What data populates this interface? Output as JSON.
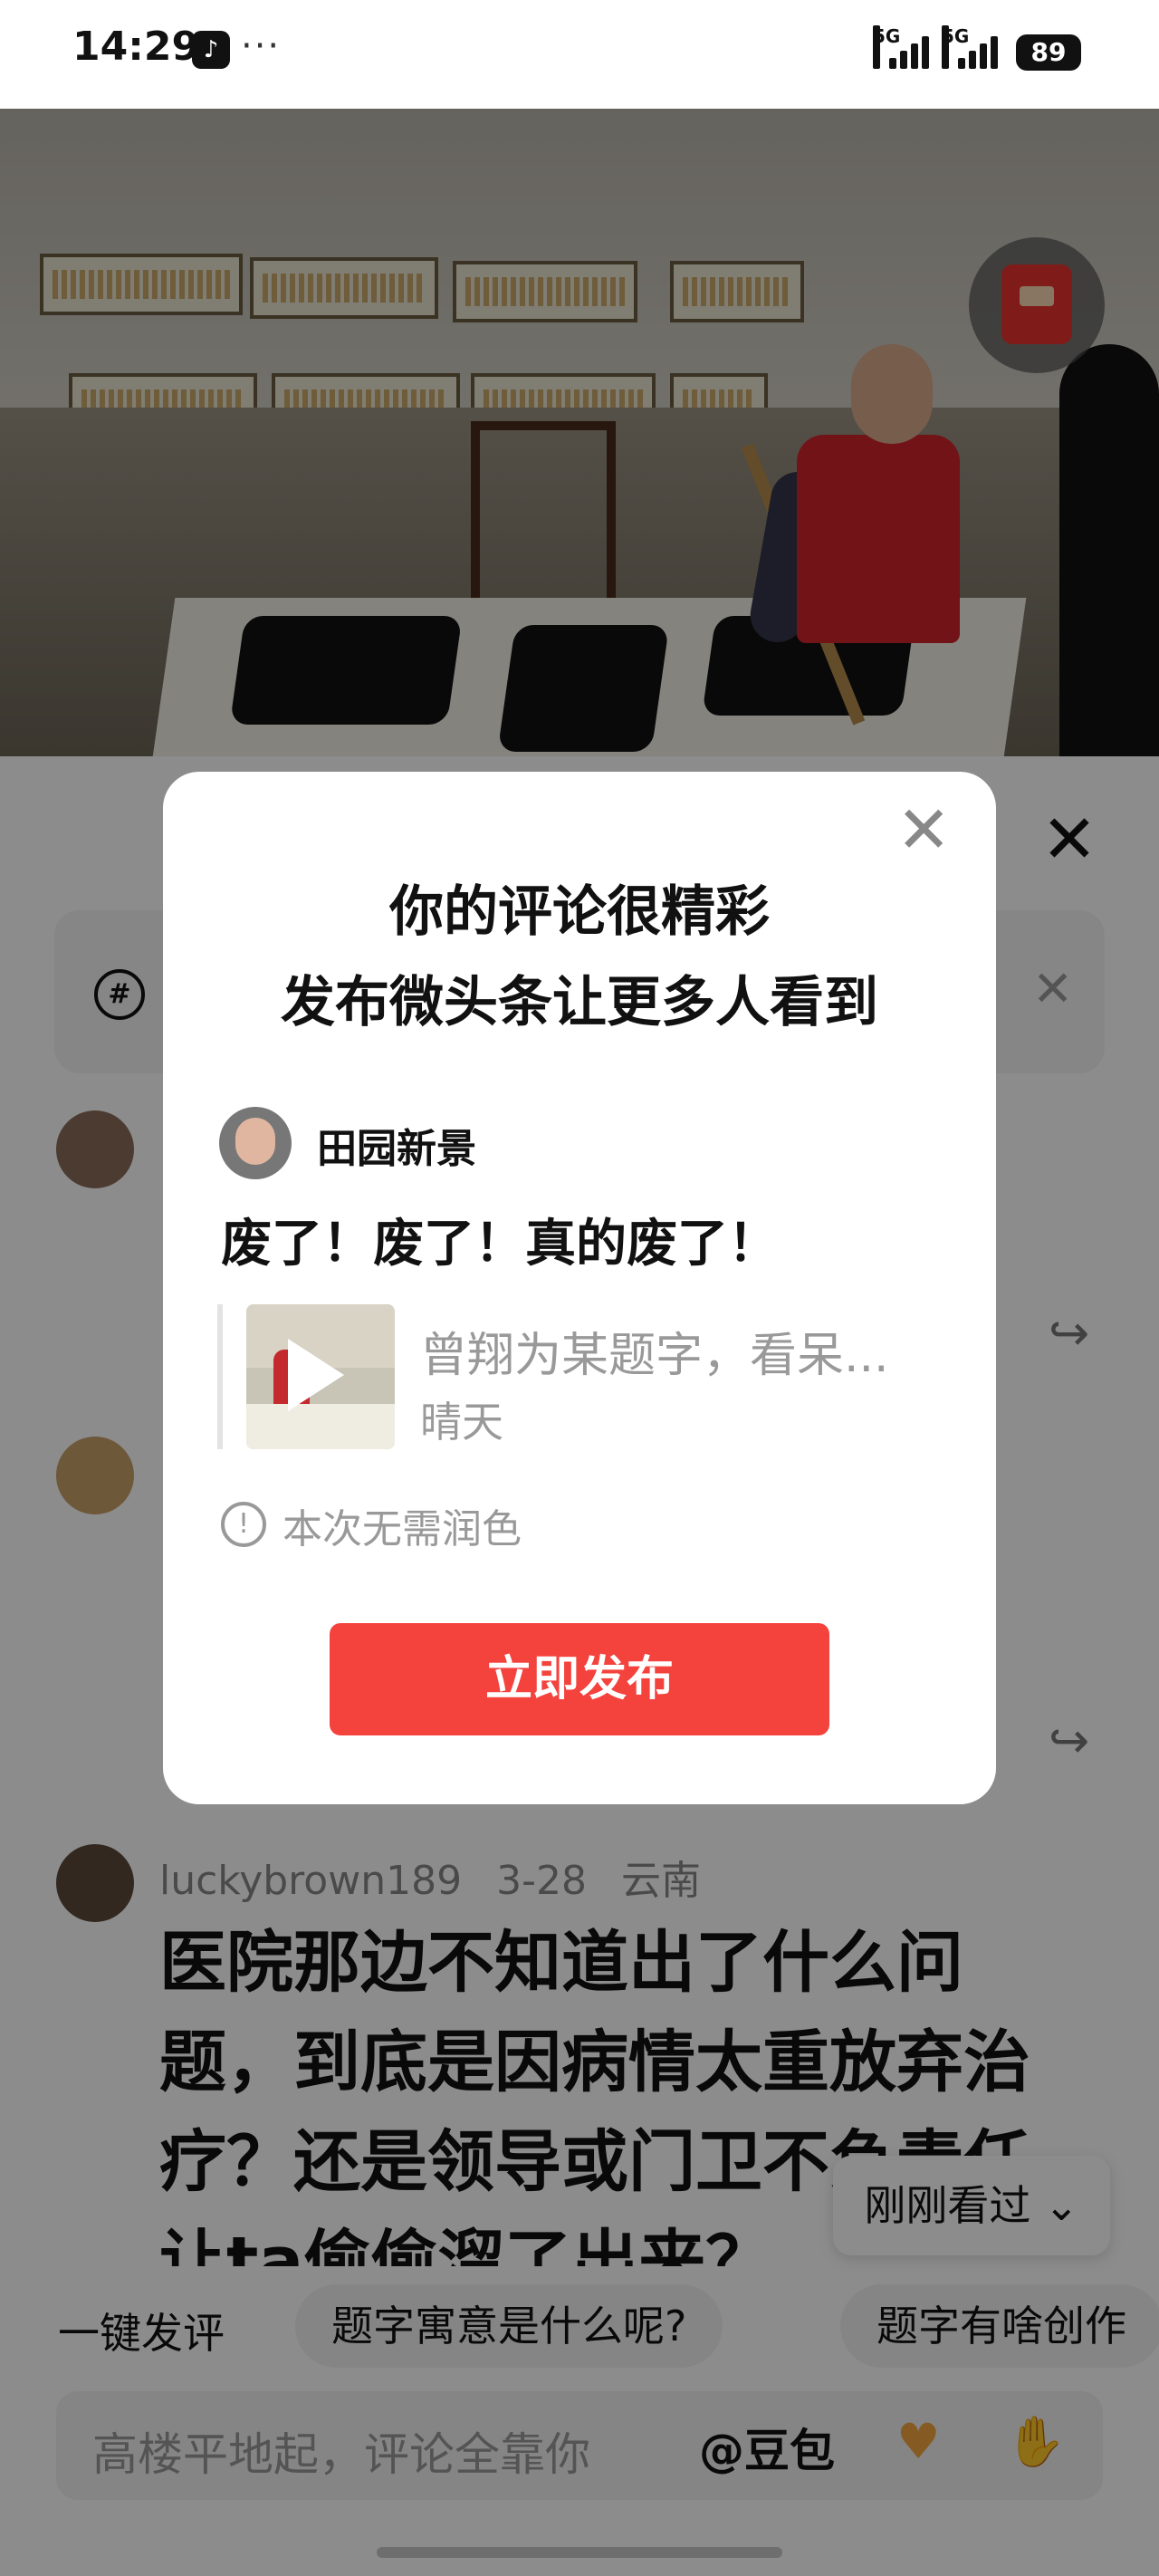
{
  "status_bar": {
    "time": "14:29",
    "app_badge": "♪",
    "more": "···",
    "signal1": "5G",
    "signal2": "5G",
    "battery": "89"
  },
  "topic_bar": {
    "icon": "#",
    "close": "✕"
  },
  "panel": {
    "close": "✕"
  },
  "comment": {
    "username": "luckybrown189",
    "date": "3-28",
    "location": "云南",
    "text": "医院那边不知道出了什么问题，到底是因病情太重放弃治疗？还是领导或门卫不负责任让ta偷偷溜了出来？"
  },
  "recently_viewed": "刚刚看过 ⌄",
  "quick_reply": {
    "label": "一键发评",
    "chips": [
      "题字寓意是什么呢?",
      "题字有啥创作"
    ]
  },
  "input": {
    "placeholder": "高楼平地起，评论全靠你",
    "doubao": "@豆包"
  },
  "modal": {
    "title_line1": "你的评论很精彩",
    "title_line2": "发布微头条让更多人看到",
    "username": "田园新景",
    "comment_text": "废了！废了！真的废了！",
    "quoted_title": "曾翔为某题字，看呆...",
    "quoted_author": "晴天",
    "info_text": "本次无需润色",
    "publish_button": "立即发布",
    "close": "✕"
  },
  "colors": {
    "accent": "#f4423d",
    "overlay": "rgba(0,0,0,0.45)"
  }
}
